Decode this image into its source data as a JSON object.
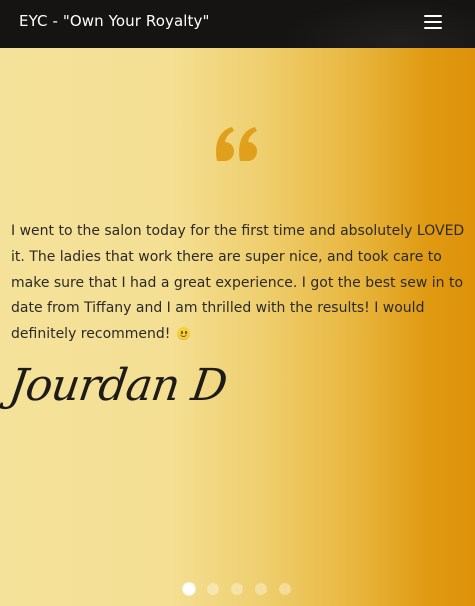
{
  "navbar": {
    "brand": "EYC - \"Own Your Royalty\"",
    "menu_icon": "hamburger-menu-icon"
  },
  "testimonial": {
    "quote_icon": "quote-mark-icon",
    "text": "I went to the salon today for the first time and absolutely LOVED it. The ladies that work there are super nice, and took care to make sure that I had a great experience. I got the best sew in to date from Tiffany and I am thrilled with the results! I would definitely recommend! ",
    "emoji": "slightly-smiling-face-icon",
    "author": "Jourdan D"
  },
  "carousel": {
    "slide_count": 5,
    "active_index": 0
  },
  "colors": {
    "navbar_bg": "#151412",
    "quote_mark": "#e0a01b",
    "text": "#2b2a27",
    "gradient_start": "#f5e29a",
    "gradient_end": "#dd920a"
  }
}
